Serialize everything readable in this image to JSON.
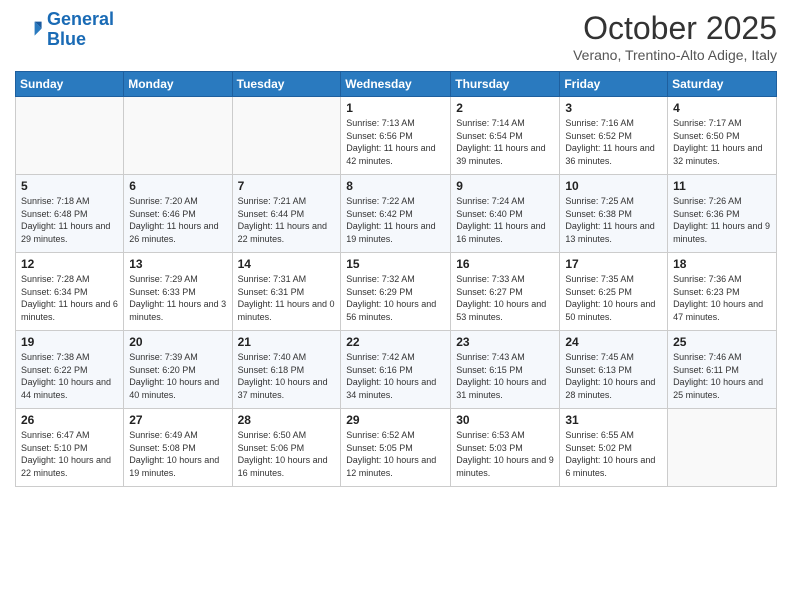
{
  "header": {
    "logo_line1": "General",
    "logo_line2": "Blue",
    "month_title": "October 2025",
    "subtitle": "Verano, Trentino-Alto Adige, Italy"
  },
  "weekdays": [
    "Sunday",
    "Monday",
    "Tuesday",
    "Wednesday",
    "Thursday",
    "Friday",
    "Saturday"
  ],
  "weeks": [
    [
      {
        "day": "",
        "info": ""
      },
      {
        "day": "",
        "info": ""
      },
      {
        "day": "",
        "info": ""
      },
      {
        "day": "1",
        "info": "Sunrise: 7:13 AM\nSunset: 6:56 PM\nDaylight: 11 hours and 42 minutes."
      },
      {
        "day": "2",
        "info": "Sunrise: 7:14 AM\nSunset: 6:54 PM\nDaylight: 11 hours and 39 minutes."
      },
      {
        "day": "3",
        "info": "Sunrise: 7:16 AM\nSunset: 6:52 PM\nDaylight: 11 hours and 36 minutes."
      },
      {
        "day": "4",
        "info": "Sunrise: 7:17 AM\nSunset: 6:50 PM\nDaylight: 11 hours and 32 minutes."
      }
    ],
    [
      {
        "day": "5",
        "info": "Sunrise: 7:18 AM\nSunset: 6:48 PM\nDaylight: 11 hours and 29 minutes."
      },
      {
        "day": "6",
        "info": "Sunrise: 7:20 AM\nSunset: 6:46 PM\nDaylight: 11 hours and 26 minutes."
      },
      {
        "day": "7",
        "info": "Sunrise: 7:21 AM\nSunset: 6:44 PM\nDaylight: 11 hours and 22 minutes."
      },
      {
        "day": "8",
        "info": "Sunrise: 7:22 AM\nSunset: 6:42 PM\nDaylight: 11 hours and 19 minutes."
      },
      {
        "day": "9",
        "info": "Sunrise: 7:24 AM\nSunset: 6:40 PM\nDaylight: 11 hours and 16 minutes."
      },
      {
        "day": "10",
        "info": "Sunrise: 7:25 AM\nSunset: 6:38 PM\nDaylight: 11 hours and 13 minutes."
      },
      {
        "day": "11",
        "info": "Sunrise: 7:26 AM\nSunset: 6:36 PM\nDaylight: 11 hours and 9 minutes."
      }
    ],
    [
      {
        "day": "12",
        "info": "Sunrise: 7:28 AM\nSunset: 6:34 PM\nDaylight: 11 hours and 6 minutes."
      },
      {
        "day": "13",
        "info": "Sunrise: 7:29 AM\nSunset: 6:33 PM\nDaylight: 11 hours and 3 minutes."
      },
      {
        "day": "14",
        "info": "Sunrise: 7:31 AM\nSunset: 6:31 PM\nDaylight: 11 hours and 0 minutes."
      },
      {
        "day": "15",
        "info": "Sunrise: 7:32 AM\nSunset: 6:29 PM\nDaylight: 10 hours and 56 minutes."
      },
      {
        "day": "16",
        "info": "Sunrise: 7:33 AM\nSunset: 6:27 PM\nDaylight: 10 hours and 53 minutes."
      },
      {
        "day": "17",
        "info": "Sunrise: 7:35 AM\nSunset: 6:25 PM\nDaylight: 10 hours and 50 minutes."
      },
      {
        "day": "18",
        "info": "Sunrise: 7:36 AM\nSunset: 6:23 PM\nDaylight: 10 hours and 47 minutes."
      }
    ],
    [
      {
        "day": "19",
        "info": "Sunrise: 7:38 AM\nSunset: 6:22 PM\nDaylight: 10 hours and 44 minutes."
      },
      {
        "day": "20",
        "info": "Sunrise: 7:39 AM\nSunset: 6:20 PM\nDaylight: 10 hours and 40 minutes."
      },
      {
        "day": "21",
        "info": "Sunrise: 7:40 AM\nSunset: 6:18 PM\nDaylight: 10 hours and 37 minutes."
      },
      {
        "day": "22",
        "info": "Sunrise: 7:42 AM\nSunset: 6:16 PM\nDaylight: 10 hours and 34 minutes."
      },
      {
        "day": "23",
        "info": "Sunrise: 7:43 AM\nSunset: 6:15 PM\nDaylight: 10 hours and 31 minutes."
      },
      {
        "day": "24",
        "info": "Sunrise: 7:45 AM\nSunset: 6:13 PM\nDaylight: 10 hours and 28 minutes."
      },
      {
        "day": "25",
        "info": "Sunrise: 7:46 AM\nSunset: 6:11 PM\nDaylight: 10 hours and 25 minutes."
      }
    ],
    [
      {
        "day": "26",
        "info": "Sunrise: 6:47 AM\nSunset: 5:10 PM\nDaylight: 10 hours and 22 minutes."
      },
      {
        "day": "27",
        "info": "Sunrise: 6:49 AM\nSunset: 5:08 PM\nDaylight: 10 hours and 19 minutes."
      },
      {
        "day": "28",
        "info": "Sunrise: 6:50 AM\nSunset: 5:06 PM\nDaylight: 10 hours and 16 minutes."
      },
      {
        "day": "29",
        "info": "Sunrise: 6:52 AM\nSunset: 5:05 PM\nDaylight: 10 hours and 12 minutes."
      },
      {
        "day": "30",
        "info": "Sunrise: 6:53 AM\nSunset: 5:03 PM\nDaylight: 10 hours and 9 minutes."
      },
      {
        "day": "31",
        "info": "Sunrise: 6:55 AM\nSunset: 5:02 PM\nDaylight: 10 hours and 6 minutes."
      },
      {
        "day": "",
        "info": ""
      }
    ]
  ]
}
